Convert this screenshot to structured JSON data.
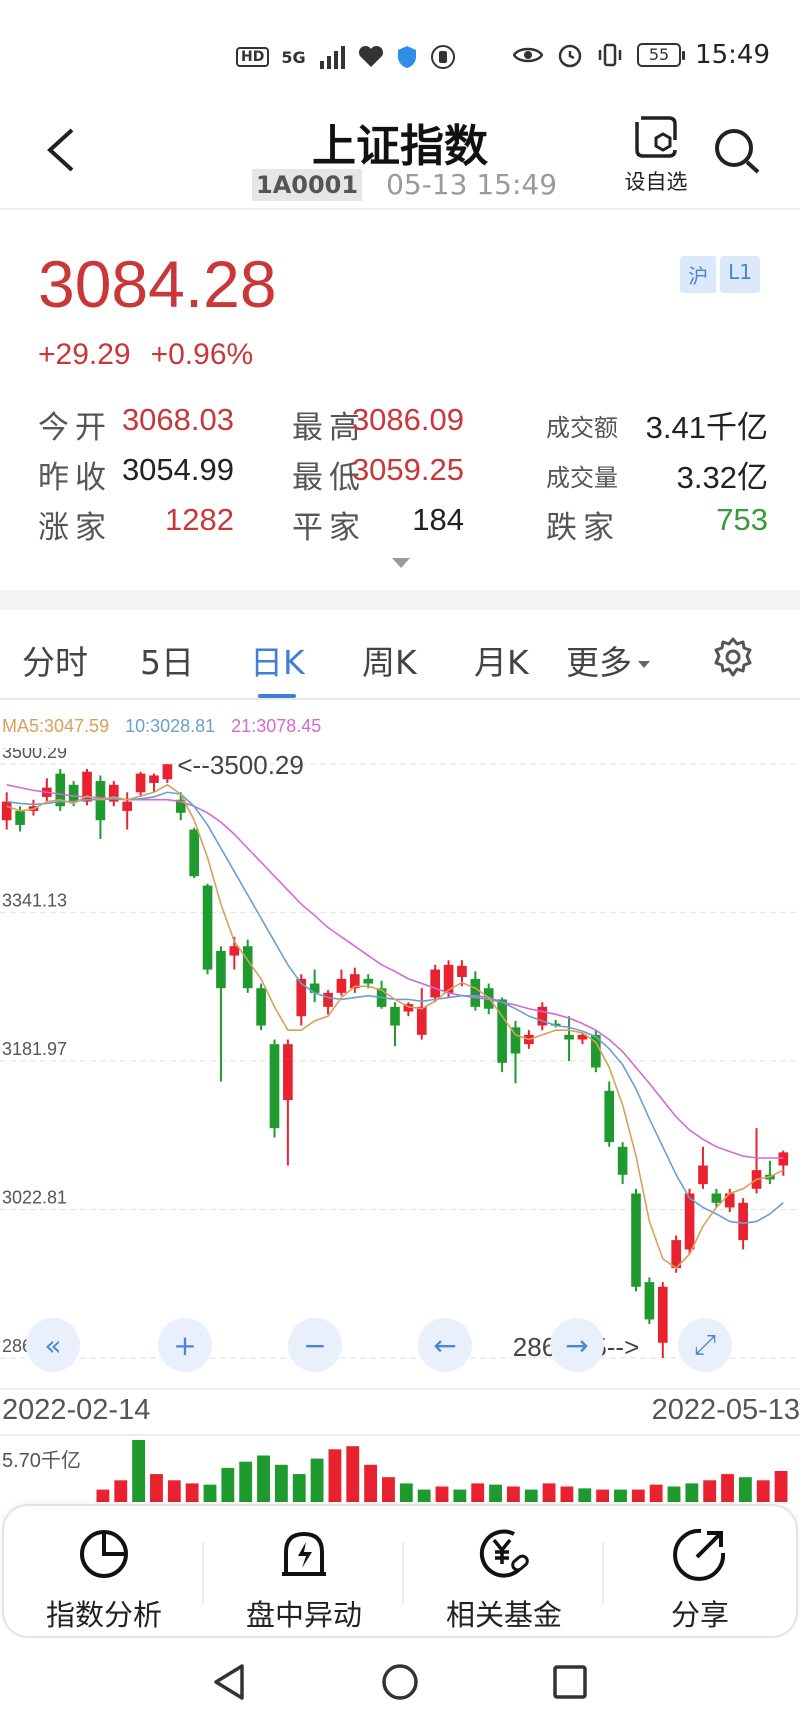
{
  "status_bar": {
    "left_badges": [
      "HD",
      "5G"
    ],
    "battery": "55",
    "time": "15:49"
  },
  "header": {
    "title": "上证指数",
    "code": "1A0001",
    "datetime": "05-13 15:49",
    "watch_label": "设自选"
  },
  "quote": {
    "price": "3084.28",
    "change_abs": "+29.29",
    "change_pct": "+0.96%",
    "tags": [
      "沪",
      "L1"
    ],
    "rows": [
      [
        {
          "label": "今开",
          "value": "3068.03",
          "color": "#c93838"
        },
        {
          "label": "最高",
          "value": "3086.09",
          "color": "#c93838"
        },
        {
          "label": "成交额",
          "value": "3.41千亿",
          "color": "#222222"
        }
      ],
      [
        {
          "label": "昨收",
          "value": "3054.99",
          "color": "#222222"
        },
        {
          "label": "最低",
          "value": "3059.25",
          "color": "#c93838"
        },
        {
          "label": "成交量",
          "value": "3.32亿",
          "color": "#222222"
        }
      ],
      [
        {
          "label": "涨家",
          "value": "1282",
          "color": "#c93838"
        },
        {
          "label": "平家",
          "value": "184",
          "color": "#222222"
        },
        {
          "label": "跌家",
          "value": "753",
          "color": "#3a9a3a"
        }
      ]
    ]
  },
  "tabs": [
    {
      "label": "分时",
      "active": false
    },
    {
      "label": "5日",
      "active": false
    },
    {
      "label": "日K",
      "active": true
    },
    {
      "label": "周K",
      "active": false
    },
    {
      "label": "月K",
      "active": false
    },
    {
      "label": "更多",
      "active": false
    }
  ],
  "ma_legend": {
    "ma5": "MA5:3047.59",
    "ma10": "10:3028.81",
    "ma21": "21:3078.45",
    "colors": {
      "ma5": "#d9a05b",
      "ma10": "#6a9fd0",
      "ma21": "#d36ad6"
    }
  },
  "chart_data": {
    "type": "candlestick",
    "y_ticks": [
      "3500.29",
      "3341.13",
      "3181.97",
      "3022.81",
      "2863.65"
    ],
    "ylim": [
      2863.65,
      3500.29
    ],
    "max_annotation": "<--3500.29",
    "min_annotation": "2863.65-->",
    "x_start": "2022-02-14",
    "x_end": "2022-05-13",
    "volume_label": "5.70千亿",
    "colors": {
      "up": "#e8222e",
      "down": "#1e9a2e"
    },
    "candles": [
      {
        "o": 3440,
        "c": 3460,
        "h": 3470,
        "l": 3430
      },
      {
        "o": 3450,
        "c": 3435,
        "h": 3455,
        "l": 3428
      },
      {
        "o": 3450,
        "c": 3455,
        "h": 3462,
        "l": 3445
      },
      {
        "o": 3465,
        "c": 3475,
        "h": 3485,
        "l": 3460
      },
      {
        "o": 3490,
        "c": 3455,
        "h": 3495,
        "l": 3450
      },
      {
        "o": 3478,
        "c": 3460,
        "h": 3482,
        "l": 3455
      },
      {
        "o": 3460,
        "c": 3492,
        "h": 3495,
        "l": 3456
      },
      {
        "o": 3482,
        "c": 3440,
        "h": 3488,
        "l": 3420
      },
      {
        "o": 3460,
        "c": 3478,
        "h": 3482,
        "l": 3455
      },
      {
        "o": 3450,
        "c": 3460,
        "h": 3470,
        "l": 3430
      },
      {
        "o": 3470,
        "c": 3490,
        "h": 3492,
        "l": 3465
      },
      {
        "o": 3480,
        "c": 3488,
        "h": 3490,
        "l": 3470
      },
      {
        "o": 3484,
        "c": 3500,
        "h": 3500.29,
        "l": 3480
      },
      {
        "o": 3462,
        "c": 3448,
        "h": 3470,
        "l": 3440
      },
      {
        "o": 3430,
        "c": 3380,
        "h": 3432,
        "l": 3378
      },
      {
        "o": 3370,
        "c": 3280,
        "h": 3372,
        "l": 3275
      },
      {
        "o": 3300,
        "c": 3260,
        "h": 3305,
        "l": 3160
      },
      {
        "o": 3295,
        "c": 3305,
        "h": 3315,
        "l": 3280
      },
      {
        "o": 3305,
        "c": 3260,
        "h": 3312,
        "l": 3255
      },
      {
        "o": 3260,
        "c": 3220,
        "h": 3265,
        "l": 3215
      },
      {
        "o": 3200,
        "c": 3110,
        "h": 3205,
        "l": 3100
      },
      {
        "o": 3140,
        "c": 3200,
        "h": 3205,
        "l": 3070
      },
      {
        "o": 3230,
        "c": 3270,
        "h": 3275,
        "l": 3220
      },
      {
        "o": 3265,
        "c": 3255,
        "h": 3280,
        "l": 3245
      },
      {
        "o": 3240,
        "c": 3255,
        "h": 3258,
        "l": 3232
      },
      {
        "o": 3255,
        "c": 3270,
        "h": 3280,
        "l": 3252
      },
      {
        "o": 3260,
        "c": 3275,
        "h": 3282,
        "l": 3255
      },
      {
        "o": 3270,
        "c": 3265,
        "h": 3275,
        "l": 3260
      },
      {
        "o": 3260,
        "c": 3240,
        "h": 3268,
        "l": 3238
      },
      {
        "o": 3240,
        "c": 3220,
        "h": 3245,
        "l": 3198
      },
      {
        "o": 3235,
        "c": 3243,
        "h": 3245,
        "l": 3230
      },
      {
        "o": 3210,
        "c": 3240,
        "h": 3260,
        "l": 3205
      },
      {
        "o": 3250,
        "c": 3280,
        "h": 3285,
        "l": 3245
      },
      {
        "o": 3255,
        "c": 3285,
        "h": 3290,
        "l": 3250
      },
      {
        "o": 3272,
        "c": 3284,
        "h": 3290,
        "l": 3262
      },
      {
        "o": 3270,
        "c": 3240,
        "h": 3278,
        "l": 3236
      },
      {
        "o": 3260,
        "c": 3238,
        "h": 3265,
        "l": 3232
      },
      {
        "o": 3248,
        "c": 3180,
        "h": 3250,
        "l": 3170
      },
      {
        "o": 3218,
        "c": 3190,
        "h": 3225,
        "l": 3158
      },
      {
        "o": 3200,
        "c": 3210,
        "h": 3215,
        "l": 3195
      },
      {
        "o": 3220,
        "c": 3240,
        "h": 3245,
        "l": 3215
      },
      {
        "o": 3222,
        "c": 3220,
        "h": 3226,
        "l": 3218
      },
      {
        "o": 3210,
        "c": 3205,
        "h": 3230,
        "l": 3182
      },
      {
        "o": 3205,
        "c": 3210,
        "h": 3212,
        "l": 3200
      },
      {
        "o": 3210,
        "c": 3175,
        "h": 3215,
        "l": 3170
      },
      {
        "o": 3150,
        "c": 3095,
        "h": 3160,
        "l": 3090
      },
      {
        "o": 3090,
        "c": 3060,
        "h": 3095,
        "l": 3050
      },
      {
        "o": 3040,
        "c": 2940,
        "h": 3045,
        "l": 2935
      },
      {
        "o": 2945,
        "c": 2905,
        "h": 2950,
        "l": 2900
      },
      {
        "o": 2880,
        "c": 2940,
        "h": 2945,
        "l": 2863.65
      },
      {
        "o": 2960,
        "c": 2990,
        "h": 2995,
        "l": 2955
      },
      {
        "o": 2980,
        "c": 3040,
        "h": 3045,
        "l": 2975
      },
      {
        "o": 3050,
        "c": 3070,
        "h": 3090,
        "l": 3045
      },
      {
        "o": 3040,
        "c": 3030,
        "h": 3045,
        "l": 3025
      },
      {
        "o": 3025,
        "c": 3040,
        "h": 3045,
        "l": 3020
      },
      {
        "o": 2990,
        "c": 3030,
        "h": 3035,
        "l": 2980
      },
      {
        "o": 3045,
        "c": 3065,
        "h": 3110,
        "l": 3040
      },
      {
        "o": 3060,
        "c": 3055,
        "h": 3075,
        "l": 3050
      },
      {
        "o": 3070,
        "c": 3084,
        "h": 3086,
        "l": 3059
      }
    ],
    "ma5": [
      3455,
      3450,
      3452,
      3460,
      3462,
      3458,
      3466,
      3462,
      3465,
      3462,
      3466,
      3470,
      3478,
      3468,
      3440,
      3400,
      3350,
      3310,
      3290,
      3270,
      3240,
      3215,
      3215,
      3225,
      3230,
      3250,
      3262,
      3262,
      3258,
      3248,
      3240,
      3238,
      3246,
      3258,
      3266,
      3260,
      3250,
      3230,
      3210,
      3205,
      3210,
      3215,
      3215,
      3212,
      3202,
      3175,
      3135,
      3080,
      3010,
      2970,
      2960,
      2975,
      3005,
      3025,
      3040,
      3045,
      3055,
      3058,
      3065
    ],
    "ma10": [
      3460,
      3458,
      3457,
      3458,
      3460,
      3460,
      3462,
      3462,
      3463,
      3462,
      3463,
      3465,
      3470,
      3468,
      3455,
      3435,
      3410,
      3385,
      3360,
      3335,
      3310,
      3285,
      3265,
      3255,
      3250,
      3248,
      3250,
      3252,
      3250,
      3248,
      3248,
      3246,
      3248,
      3250,
      3252,
      3252,
      3250,
      3245,
      3238,
      3230,
      3225,
      3220,
      3218,
      3214,
      3208,
      3195,
      3178,
      3152,
      3120,
      3090,
      3060,
      3035,
      3025,
      3018,
      3010,
      3008,
      3010,
      3018,
      3030
    ],
    "ma21": [
      3478,
      3475,
      3472,
      3470,
      3468,
      3466,
      3465,
      3464,
      3463,
      3462,
      3462,
      3462,
      3462,
      3460,
      3455,
      3448,
      3438,
      3425,
      3410,
      3395,
      3380,
      3365,
      3350,
      3338,
      3325,
      3315,
      3305,
      3295,
      3285,
      3278,
      3270,
      3265,
      3260,
      3255,
      3252,
      3250,
      3248,
      3245,
      3242,
      3238,
      3235,
      3232,
      3228,
      3222,
      3215,
      3205,
      3192,
      3175,
      3158,
      3140,
      3122,
      3108,
      3098,
      3090,
      3085,
      3080,
      3078,
      3078,
      3078
    ],
    "volume": [
      {
        "v": 0.2,
        "up": true
      },
      {
        "v": 0.35,
        "up": true
      },
      {
        "v": 1.0,
        "up": false
      },
      {
        "v": 0.45,
        "up": true
      },
      {
        "v": 0.35,
        "up": true
      },
      {
        "v": 0.3,
        "up": true
      },
      {
        "v": 0.28,
        "up": false
      },
      {
        "v": 0.55,
        "up": false
      },
      {
        "v": 0.65,
        "up": false
      },
      {
        "v": 0.75,
        "up": false
      },
      {
        "v": 0.6,
        "up": false
      },
      {
        "v": 0.45,
        "up": false
      },
      {
        "v": 0.7,
        "up": false
      },
      {
        "v": 0.85,
        "up": true
      },
      {
        "v": 0.9,
        "up": true
      },
      {
        "v": 0.6,
        "up": true
      },
      {
        "v": 0.4,
        "up": true
      },
      {
        "v": 0.3,
        "up": false
      },
      {
        "v": 0.2,
        "up": false
      },
      {
        "v": 0.25,
        "up": true
      },
      {
        "v": 0.2,
        "up": false
      },
      {
        "v": 0.3,
        "up": true
      },
      {
        "v": 0.28,
        "up": false
      },
      {
        "v": 0.25,
        "up": true
      },
      {
        "v": 0.2,
        "up": false
      },
      {
        "v": 0.3,
        "up": true
      },
      {
        "v": 0.25,
        "up": true
      },
      {
        "v": 0.22,
        "up": false
      },
      {
        "v": 0.2,
        "up": true
      },
      {
        "v": 0.2,
        "up": false
      },
      {
        "v": 0.2,
        "up": true
      },
      {
        "v": 0.28,
        "up": true
      },
      {
        "v": 0.25,
        "up": false
      },
      {
        "v": 0.3,
        "up": false
      },
      {
        "v": 0.35,
        "up": true
      },
      {
        "v": 0.45,
        "up": true
      },
      {
        "v": 0.4,
        "up": false
      },
      {
        "v": 0.35,
        "up": true
      },
      {
        "v": 0.5,
        "up": true
      }
    ]
  },
  "chart_controls": [
    {
      "name": "fast-backward-button",
      "glyph": "«"
    },
    {
      "name": "zoom-in-button",
      "glyph": "+"
    },
    {
      "name": "zoom-out-button",
      "glyph": "−"
    },
    {
      "name": "left-button",
      "glyph": "←"
    },
    {
      "name": "right-button",
      "glyph": "→"
    },
    {
      "name": "fullscreen-button",
      "glyph": "⤢"
    }
  ],
  "bottom_bar": {
    "items": [
      "指数分析",
      "盘中异动",
      "相关基金",
      "分享"
    ]
  }
}
